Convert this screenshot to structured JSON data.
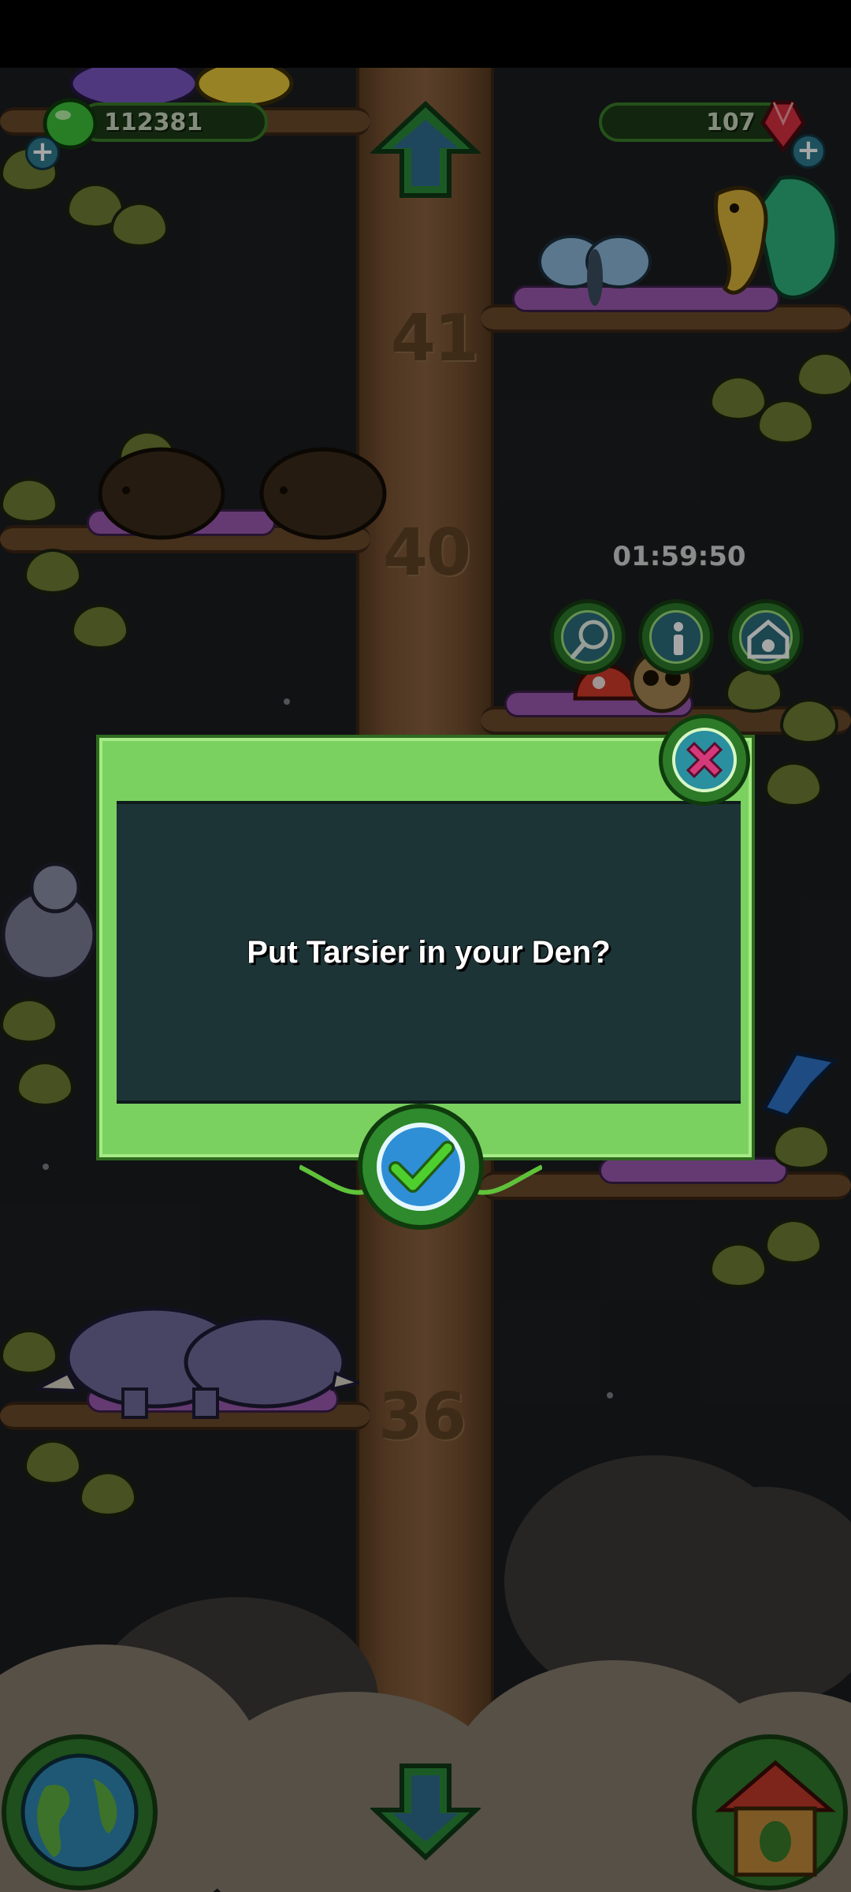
{
  "hud": {
    "currency": "112381",
    "gems": "107"
  },
  "timer": "01:59:50",
  "levels": [
    "41",
    "40",
    "36"
  ],
  "dialog": {
    "message": "Put Tarsier in your Den?"
  },
  "icons": {
    "currency": "green-gem-icon",
    "gems": "red-crystal-icon",
    "add": "plus-icon",
    "up": "up-arrow-icon",
    "down": "down-arrow-icon",
    "net": "butterfly-net-icon",
    "info": "info-icon",
    "den": "den-icon",
    "world": "globe-icon",
    "home": "birdhouse-icon",
    "close": "close-icon",
    "confirm": "checkmark-icon"
  },
  "colors": {
    "dialog_frame": "#7ad160",
    "dialog_panel": "#1d3437",
    "close_x": "#d43a7a",
    "confirm_check": "#4fcf2e",
    "button_teal": "#2c6c7c"
  }
}
